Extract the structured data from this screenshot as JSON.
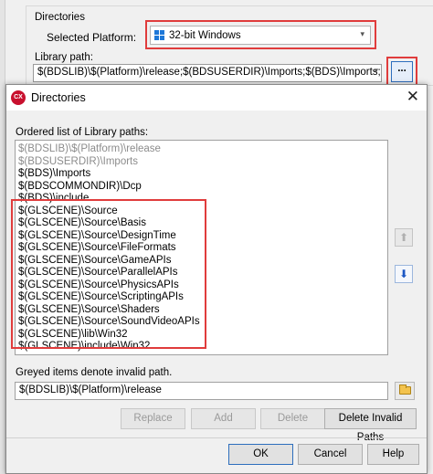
{
  "parent": {
    "directories_label": "Directories",
    "selected_platform_label": "Selected Platform:",
    "platform_value": "32-bit Windows",
    "library_path_label": "Library path:",
    "library_path_value": "$(BDSLIB)\\$(Platform)\\release;$(BDSUSERDIR)\\Imports;$(BDS)\\Imports;$(BDSCOM",
    "browse_label": "..."
  },
  "dialog": {
    "title": "Directories",
    "app_icon_text": "CX",
    "close_glyph": "✕",
    "ordered_list_label": "Ordered list of Library paths:",
    "paths": [
      {
        "text": "$(BDSLIB)\\$(Platform)\\release",
        "invalid": true
      },
      {
        "text": "$(BDSUSERDIR)\\Imports",
        "invalid": true
      },
      {
        "text": "$(BDS)\\Imports",
        "invalid": false
      },
      {
        "text": "$(BDSCOMMONDIR)\\Dcp",
        "invalid": false
      },
      {
        "text": "$(BDS)\\include",
        "invalid": false
      },
      {
        "text": "$(GLSCENE)\\Source",
        "invalid": false
      },
      {
        "text": "$(GLSCENE)\\Source\\Basis",
        "invalid": false
      },
      {
        "text": "$(GLSCENE)\\Source\\DesignTime",
        "invalid": false
      },
      {
        "text": "$(GLSCENE)\\Source\\FileFormats",
        "invalid": false
      },
      {
        "text": "$(GLSCENE)\\Source\\GameAPIs",
        "invalid": false
      },
      {
        "text": "$(GLSCENE)\\Source\\ParallelAPIs",
        "invalid": false
      },
      {
        "text": "$(GLSCENE)\\Source\\PhysicsAPIs",
        "invalid": false
      },
      {
        "text": "$(GLSCENE)\\Source\\ScriptingAPIs",
        "invalid": false
      },
      {
        "text": "$(GLSCENE)\\Source\\Shaders",
        "invalid": false
      },
      {
        "text": "$(GLSCENE)\\Source\\SoundVideoAPIs",
        "invalid": false
      },
      {
        "text": "$(GLSCENE)\\lib\\Win32",
        "invalid": false
      },
      {
        "text": "$(GLSCENE)\\include\\Win32",
        "invalid": false
      }
    ],
    "move_up_glyph": "⬆",
    "move_down_glyph": "⬇",
    "greyed_note": "Greyed items denote invalid path.",
    "path_input_value": "$(BDSLIB)\\$(Platform)\\release",
    "buttons": {
      "replace": "Replace",
      "add": "Add",
      "delete": "Delete",
      "delete_invalid": "Delete Invalid Paths",
      "ok": "OK",
      "cancel": "Cancel",
      "help": "Help"
    }
  },
  "colors": {
    "highlight_box": "#e03c3c",
    "invalid_path_text": "#8c8c8c",
    "down_arrow": "#1b57c4"
  },
  "icons": {
    "platform": "windows-logo-icon",
    "browse": "ellipsis-icon",
    "app": "cx-app-icon",
    "close": "close-icon",
    "move_up": "arrow-up-icon",
    "move_down": "arrow-down-icon",
    "folder": "folder-icon"
  }
}
